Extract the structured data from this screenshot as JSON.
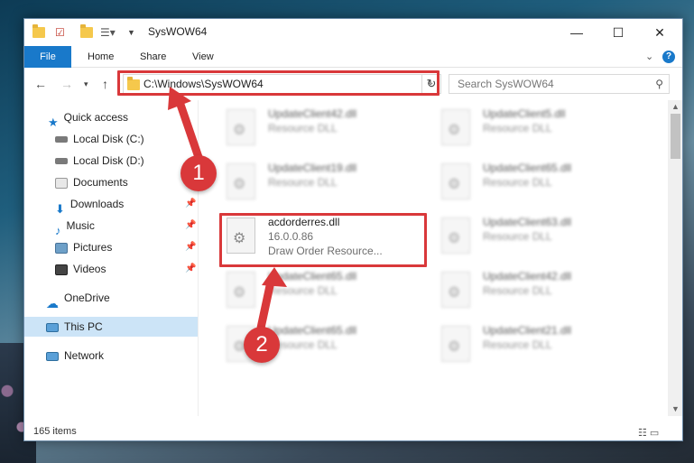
{
  "window": {
    "title": "SysWOW64"
  },
  "ribbon": {
    "tabs": [
      "File",
      "Home",
      "Share",
      "View"
    ]
  },
  "address": {
    "path": "C:\\Windows\\SysWOW64",
    "search_placeholder": "Search SysWOW64"
  },
  "sidebar": {
    "items": [
      {
        "label": "Quick access",
        "icon": "star-icon"
      },
      {
        "label": "Local Disk (C:)",
        "icon": "drive-icon"
      },
      {
        "label": "Local Disk (D:)",
        "icon": "drive-icon"
      },
      {
        "label": "Documents",
        "icon": "documents-icon"
      },
      {
        "label": "Downloads",
        "icon": "download-icon"
      },
      {
        "label": "Music",
        "icon": "music-icon"
      },
      {
        "label": "Pictures",
        "icon": "pictures-icon"
      },
      {
        "label": "Videos",
        "icon": "videos-icon"
      },
      {
        "label": "OneDrive",
        "icon": "cloud-icon"
      },
      {
        "label": "This PC",
        "icon": "computer-icon"
      },
      {
        "label": "Network",
        "icon": "network-icon"
      }
    ]
  },
  "files": {
    "col1": [
      {
        "name": "UpdateClient42.dll",
        "line2": "Resource DLL"
      },
      {
        "name": "UpdateClient19.dll",
        "line2": "Resource DLL"
      },
      {
        "name": "acdorderres.dll",
        "line2": "16.0.0.86",
        "line3": "Draw Order Resource..."
      },
      {
        "name": "UpdateClient65.dll",
        "line2": "Resource DLL"
      },
      {
        "name": "UpdateClient65.dll",
        "line2": "Resource DLL"
      }
    ],
    "col2": [
      {
        "name": "UpdateClient5.dll",
        "line2": "Resource DLL"
      },
      {
        "name": "UpdateClient65.dll",
        "line2": "Resource DLL"
      },
      {
        "name": "UpdateClient63.dll",
        "line2": "Resource DLL"
      },
      {
        "name": "UpdateClient42.dll",
        "line2": "Resource DLL"
      },
      {
        "name": "UpdateClient21.dll",
        "line2": "Resource DLL"
      }
    ]
  },
  "status": {
    "count": "165 items"
  },
  "annotations": {
    "step1": "1",
    "step2": "2",
    "color": "#d9383a"
  }
}
